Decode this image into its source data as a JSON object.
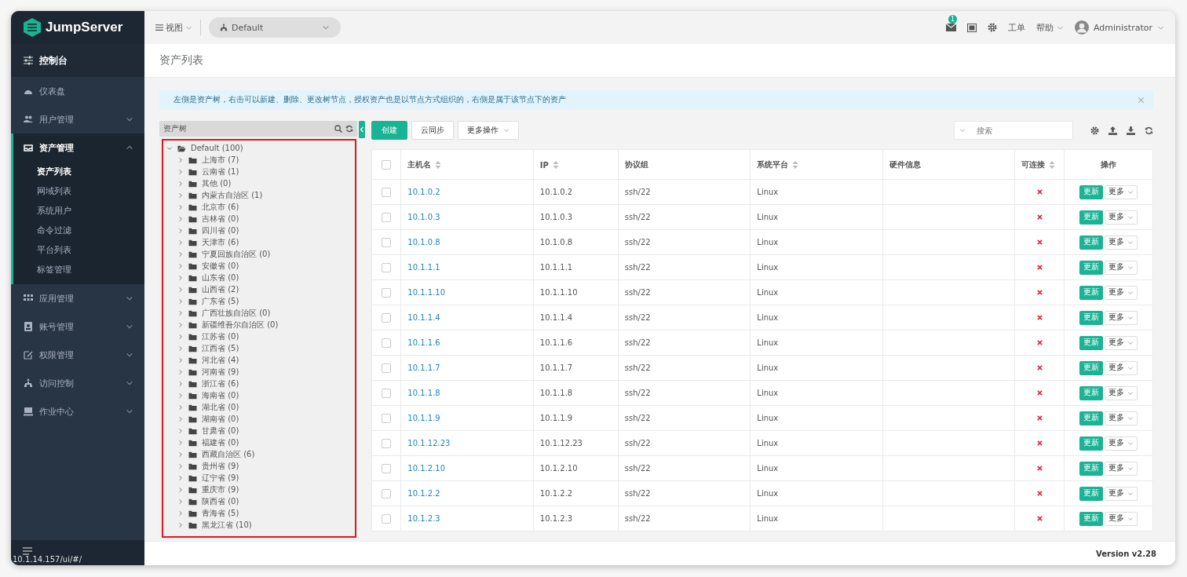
{
  "brand": {
    "name": "JumpServer"
  },
  "sidebar": {
    "console": "控制台",
    "items": [
      {
        "kind": "link",
        "label": "仪表盘"
      },
      {
        "kind": "group",
        "label": "用户管理",
        "expanded": false
      },
      {
        "kind": "group",
        "label": "资产管理",
        "expanded": true,
        "children": [
          {
            "label": "资产列表",
            "selected": true
          },
          {
            "label": "网域列表",
            "selected": false
          },
          {
            "label": "系统用户",
            "selected": false
          },
          {
            "label": "命令过滤",
            "selected": false
          },
          {
            "label": "平台列表",
            "selected": false
          },
          {
            "label": "标签管理",
            "selected": false
          }
        ]
      },
      {
        "kind": "group",
        "label": "应用管理",
        "expanded": false
      },
      {
        "kind": "group",
        "label": "账号管理",
        "expanded": false
      },
      {
        "kind": "group",
        "label": "权限管理",
        "expanded": false
      },
      {
        "kind": "group",
        "label": "访问控制",
        "expanded": false
      },
      {
        "kind": "group",
        "label": "作业中心",
        "expanded": false
      }
    ],
    "url": "10.1.14.157/ui/#/"
  },
  "topbar": {
    "view_menu": "视图",
    "node_select": "Default",
    "mail_badge": "1",
    "tickets": "工单",
    "help": "帮助",
    "user": "Administrator"
  },
  "page_title": "资产列表",
  "alert": "左側是资产树，右击可以新建、删除、更改树节点，授权资产也是以节点方式组织的，右側是属于该节点下的资产",
  "tree": {
    "title": "资产树",
    "root": {
      "label": "Default (100)",
      "expanded": true,
      "children": [
        {
          "label": "上海市 (7)",
          "expanded": false
        },
        {
          "label": "云南省 (1)",
          "expanded": false
        },
        {
          "label": "其他 (0)",
          "expanded": false
        },
        {
          "label": "内蒙古自治区 (1)",
          "expanded": false
        },
        {
          "label": "北京市 (6)",
          "expanded": false
        },
        {
          "label": "吉林省 (0)",
          "expanded": false
        },
        {
          "label": "四川省 (0)",
          "expanded": false
        },
        {
          "label": "天津市 (6)",
          "expanded": false
        },
        {
          "label": "宁夏回族自治区 (0)",
          "expanded": false
        },
        {
          "label": "安徽省 (0)",
          "expanded": false
        },
        {
          "label": "山东省 (0)",
          "expanded": false
        },
        {
          "label": "山西省 (2)",
          "expanded": false
        },
        {
          "label": "广东省 (5)",
          "expanded": false
        },
        {
          "label": "广西壮族自治区 (0)",
          "expanded": false
        },
        {
          "label": "新疆维吾尔自治区 (0)",
          "expanded": false
        },
        {
          "label": "江苏省 (0)",
          "expanded": false
        },
        {
          "label": "江西省 (5)",
          "expanded": false
        },
        {
          "label": "河北省 (4)",
          "expanded": false
        },
        {
          "label": "河南省 (9)",
          "expanded": false
        },
        {
          "label": "浙江省 (6)",
          "expanded": false
        },
        {
          "label": "海南省 (0)",
          "expanded": false
        },
        {
          "label": "湖北省 (0)",
          "expanded": false
        },
        {
          "label": "湖南省 (0)",
          "expanded": false
        },
        {
          "label": "甘肃省 (0)",
          "expanded": false
        },
        {
          "label": "福建省 (0)",
          "expanded": false
        },
        {
          "label": "西藏自治区 (6)",
          "expanded": false
        },
        {
          "label": "贵州省 (9)",
          "expanded": false
        },
        {
          "label": "辽宁省 (9)",
          "expanded": false
        },
        {
          "label": "重庆市 (9)",
          "expanded": false
        },
        {
          "label": "陕西省 (0)",
          "expanded": false
        },
        {
          "label": "青海省 (5)",
          "expanded": false
        },
        {
          "label": "黑龙江省 (10)",
          "expanded": false
        }
      ]
    }
  },
  "toolbar": {
    "create": "创建",
    "cloud_sync": "云同步",
    "more_actions": "更多操作",
    "search_placeholder": "搜索"
  },
  "table": {
    "select_all_checked": false,
    "columns": [
      {
        "label": "主机名",
        "sortable": true
      },
      {
        "label": "IP",
        "sortable": true
      },
      {
        "label": "协议组",
        "sortable": false
      },
      {
        "label": "系统平台",
        "sortable": true
      },
      {
        "label": "硬件信息",
        "sortable": false
      },
      {
        "label": "可连接",
        "sortable": true
      },
      {
        "label": "操作",
        "sortable": false
      }
    ],
    "rows": [
      {
        "hostname": "10.1.0.2",
        "ip": "10.1.0.2",
        "protocols": "ssh/22",
        "platform": "Linux",
        "connectable": false,
        "checked": false,
        "update": "更新",
        "more": "更多"
      },
      {
        "hostname": "10.1.0.3",
        "ip": "10.1.0.3",
        "protocols": "ssh/22",
        "platform": "Linux",
        "connectable": false,
        "checked": false,
        "update": "更新",
        "more": "更多"
      },
      {
        "hostname": "10.1.0.8",
        "ip": "10.1.0.8",
        "protocols": "ssh/22",
        "platform": "Linux",
        "connectable": false,
        "checked": false,
        "update": "更新",
        "more": "更多"
      },
      {
        "hostname": "10.1.1.1",
        "ip": "10.1.1.1",
        "protocols": "ssh/22",
        "platform": "Linux",
        "connectable": false,
        "checked": false,
        "update": "更新",
        "more": "更多"
      },
      {
        "hostname": "10.1.1.10",
        "ip": "10.1.1.10",
        "protocols": "ssh/22",
        "platform": "Linux",
        "connectable": false,
        "checked": false,
        "update": "更新",
        "more": "更多"
      },
      {
        "hostname": "10.1.1.4",
        "ip": "10.1.1.4",
        "protocols": "ssh/22",
        "platform": "Linux",
        "connectable": false,
        "checked": false,
        "update": "更新",
        "more": "更多"
      },
      {
        "hostname": "10.1.1.6",
        "ip": "10.1.1.6",
        "protocols": "ssh/22",
        "platform": "Linux",
        "connectable": false,
        "checked": false,
        "update": "更新",
        "more": "更多"
      },
      {
        "hostname": "10.1.1.7",
        "ip": "10.1.1.7",
        "protocols": "ssh/22",
        "platform": "Linux",
        "connectable": false,
        "checked": false,
        "update": "更新",
        "more": "更多"
      },
      {
        "hostname": "10.1.1.8",
        "ip": "10.1.1.8",
        "protocols": "ssh/22",
        "platform": "Linux",
        "connectable": false,
        "checked": false,
        "update": "更新",
        "more": "更多"
      },
      {
        "hostname": "10.1.1.9",
        "ip": "10.1.1.9",
        "protocols": "ssh/22",
        "platform": "Linux",
        "connectable": false,
        "checked": false,
        "update": "更新",
        "more": "更多"
      },
      {
        "hostname": "10.1.12.23",
        "ip": "10.1.12.23",
        "protocols": "ssh/22",
        "platform": "Linux",
        "connectable": false,
        "checked": false,
        "update": "更新",
        "more": "更多"
      },
      {
        "hostname": "10.1.2.10",
        "ip": "10.1.2.10",
        "protocols": "ssh/22",
        "platform": "Linux",
        "connectable": false,
        "checked": false,
        "update": "更新",
        "more": "更多"
      },
      {
        "hostname": "10.1.2.2",
        "ip": "10.1.2.2",
        "protocols": "ssh/22",
        "platform": "Linux",
        "connectable": false,
        "checked": false,
        "update": "更新",
        "more": "更多"
      },
      {
        "hostname": "10.1.2.3",
        "ip": "10.1.2.3",
        "protocols": "ssh/22",
        "platform": "Linux",
        "connectable": false,
        "checked": false,
        "update": "更新",
        "more": "更多"
      }
    ]
  },
  "footer": {
    "version": "Version v2.28"
  }
}
